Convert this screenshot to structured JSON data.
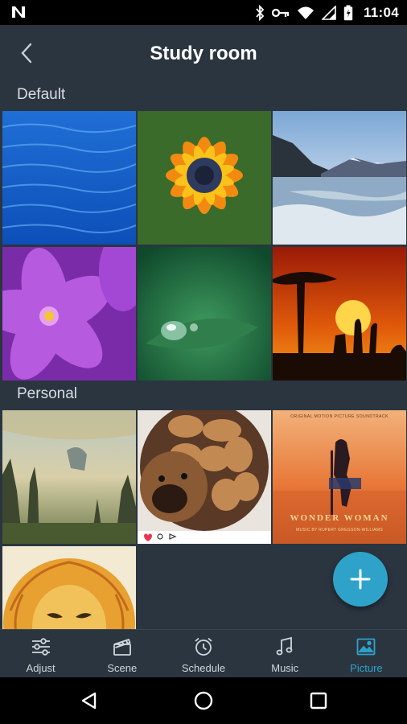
{
  "status_bar": {
    "time": "11:04",
    "icons": [
      "notification-n-icon",
      "bluetooth-icon",
      "vpn-key-icon",
      "wifi-icon",
      "cellular-icon",
      "battery-icon"
    ]
  },
  "header": {
    "title": "Study room",
    "back_icon": "chevron-left-icon"
  },
  "sections": [
    {
      "label": "Default",
      "images": [
        "ocean-water",
        "orange-flower",
        "mountain-lake",
        "purple-flower",
        "water-drop-leaf",
        "sunset-savanna"
      ]
    },
    {
      "label": "Personal",
      "images": [
        "fantasy-landscape",
        "puppies-photo",
        "wonder-woman-album",
        "lion-drawing"
      ]
    }
  ],
  "album_cover": {
    "top_text": "ORIGINAL MOTION PICTURE SOUNDTRACK",
    "title": "WONDER WOMAN",
    "credit": "MUSIC BY RUPERT GREGSON-WILLIAMS"
  },
  "fab": {
    "icon": "plus-icon"
  },
  "bottom_nav": {
    "active": "Picture",
    "items": [
      {
        "label": "Adjust",
        "icon": "sliders-icon"
      },
      {
        "label": "Scene",
        "icon": "clapperboard-icon"
      },
      {
        "label": "Schedule",
        "icon": "alarm-clock-icon"
      },
      {
        "label": "Music",
        "icon": "music-note-icon"
      },
      {
        "label": "Picture",
        "icon": "image-icon"
      }
    ]
  },
  "colors": {
    "background": "#2b3540",
    "accent": "#2ea2c9",
    "nav_inactive": "#cfd6dc"
  }
}
